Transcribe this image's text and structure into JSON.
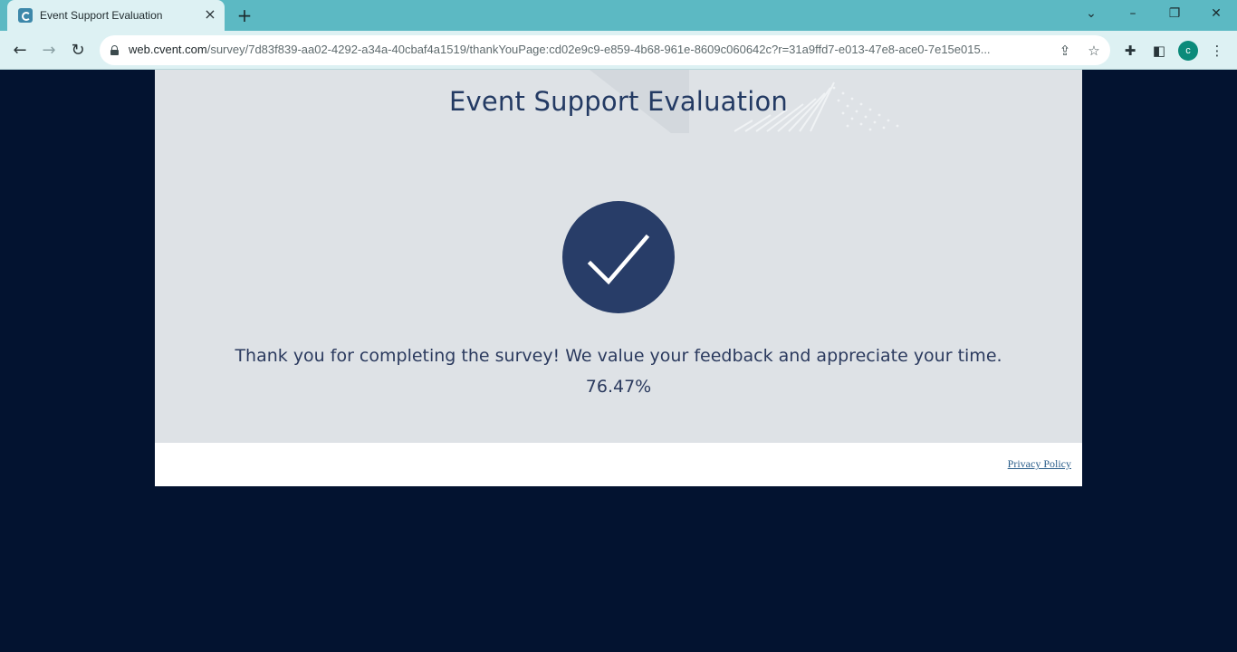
{
  "browser": {
    "tab": {
      "title": "Event Support Evaluation",
      "favicon": "cvent-favicon-icon"
    },
    "url": {
      "host": "web.cvent.com",
      "path": "/survey/7d83f839-aa02-4292-a34a-40cbaf4a1519/thankYouPage:cd02e9c9-e859-4b68-961e-8609c060642c?r=31a9ffd7-e013-47e8-ace0-7e15e015..."
    },
    "profile_initial": "c"
  },
  "survey": {
    "title": "Event Support Evaluation",
    "thank_you_message": "Thank you for completing the survey! We value your feedback and appreciate your time.",
    "progress_text": "76.47%"
  },
  "footer": {
    "privacy_link": "Privacy Policy"
  },
  "colors": {
    "page_background": "#031330",
    "card_background": "#dee2e6",
    "accent_navy": "#283d68",
    "tabstrip": "#5cb9c3"
  }
}
